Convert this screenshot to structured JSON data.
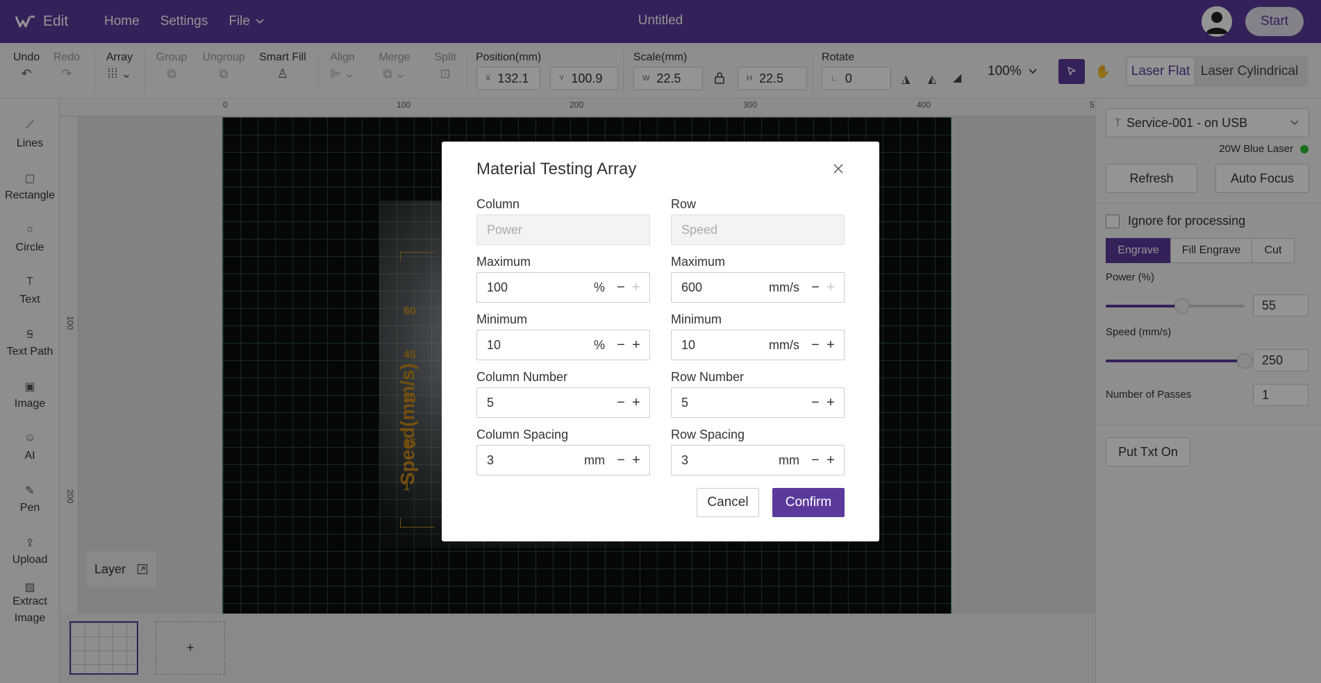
{
  "header": {
    "app_name": "Edit",
    "nav": [
      "Home",
      "Settings",
      "File"
    ],
    "document_title": "Untitled",
    "start_label": "Start"
  },
  "toolbar": {
    "undo": "Undo",
    "redo": "Redo",
    "array": "Array",
    "group": "Group",
    "ungroup": "Ungroup",
    "smart_fill": "Smart Fill",
    "align": "Align",
    "merge": "Merge",
    "split": "Split",
    "position_label": "Position(mm)",
    "pos_x_prefix": "X",
    "pos_x": "132.1",
    "pos_y_prefix": "Y",
    "pos_y": "100.9",
    "scale_label": "Scale(mm)",
    "scale_w_prefix": "W",
    "scale_w": "22.5",
    "scale_h_prefix": "H",
    "scale_h": "22.5",
    "rotate_label": "Rotate",
    "rotate": "0",
    "zoom": "100%",
    "laser_modes": [
      "Laser Flat",
      "Laser Cylindrical"
    ]
  },
  "left_tools": [
    "Lines",
    "Rectangle",
    "Circle",
    "Text",
    "Text Path",
    "Image",
    "AI",
    "Pen",
    "Upload",
    "Extract Image"
  ],
  "rulers": {
    "top": [
      "0",
      "100",
      "200",
      "300",
      "400",
      "5"
    ],
    "left": [
      "100",
      "200"
    ]
  },
  "canvas": {
    "preview_text": "Speed(mm/s)",
    "preview_ticks": [
      "60",
      "45",
      "30",
      "15",
      "1"
    ],
    "layer_label": "Layer",
    "add_page": "+"
  },
  "right_panel": {
    "device": "Service-001 - on USB",
    "laser_type": "20W Blue Laser",
    "refresh": "Refresh",
    "auto_focus": "Auto Focus",
    "ignore_label": "Ignore for processing",
    "modes": [
      "Engrave",
      "Fill Engrave",
      "Cut"
    ],
    "power_label": "Power (%)",
    "power_value": "55",
    "power_fraction": 0.55,
    "speed_label": "Speed (mm/s)",
    "speed_value": "250",
    "speed_fraction": 1.0,
    "passes_label": "Number of Passes",
    "passes_value": "1",
    "put_txt_on": "Put Txt On"
  },
  "modal": {
    "title": "Material Testing Array",
    "column_label": "Column",
    "column_placeholder": "Power",
    "row_label": "Row",
    "row_placeholder": "Speed",
    "col_max_label": "Maximum",
    "col_max": "100",
    "col_max_unit": "%",
    "row_max_label": "Maximum",
    "row_max": "600",
    "row_max_unit": "mm/s",
    "col_min_label": "Minimum",
    "col_min": "10",
    "col_min_unit": "%",
    "row_min_label": "Minimum",
    "row_min": "10",
    "row_min_unit": "mm/s",
    "col_number_label": "Column Number",
    "col_number": "5",
    "row_number_label": "Row Number",
    "row_number": "5",
    "col_spacing_label": "Column Spacing",
    "col_spacing": "3",
    "col_spacing_unit": "mm",
    "row_spacing_label": "Row Spacing",
    "row_spacing": "3",
    "row_spacing_unit": "mm",
    "cancel": "Cancel",
    "confirm": "Confirm"
  },
  "colors": {
    "brand": "#5b3a9c",
    "status_ok": "#27c12b",
    "preview_text": "#c88a1a"
  }
}
